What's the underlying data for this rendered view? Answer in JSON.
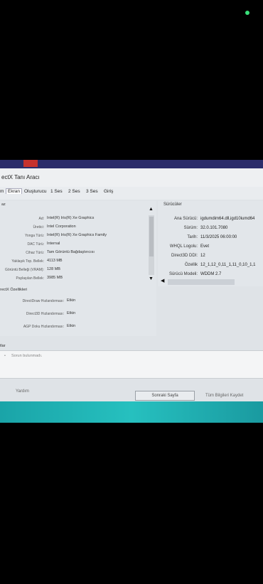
{
  "window": {
    "title": "ectX Tanı Aracı"
  },
  "tabs": [
    {
      "label": "m"
    },
    {
      "label": "Ekran"
    },
    {
      "label": "Oluşturucu"
    },
    {
      "label": "1 Ses"
    },
    {
      "label": "2 Ses"
    },
    {
      "label": "3 Ses"
    },
    {
      "label": "Giriş"
    }
  ],
  "device": {
    "header": "az",
    "rows": [
      {
        "label": "Ad:",
        "value": "Intel(R) Iris(R) Xe Graphics"
      },
      {
        "label": "Üretici:",
        "value": "Intel Corporation"
      },
      {
        "label": "Yonga Türü:",
        "value": "Intel(R) Iris(R) Xe Graphics Family"
      },
      {
        "label": "DAC Türü:",
        "value": "Internal"
      },
      {
        "label": "Cihaz Türü:",
        "value": "Tam Görüntü Bağdaştırıcısı"
      },
      {
        "label": "Yaklaşık Top. Bellek:",
        "value": "4113 MB"
      },
      {
        "label": "Görüntü Belleği (VRAM):",
        "value": "128 MB"
      },
      {
        "label": "Paylaşılan Bellek:",
        "value": "3985 MB"
      }
    ]
  },
  "directx": {
    "header": "rectX Özellikleri",
    "rows": [
      {
        "label": "DirectDraw Hızlandırması:",
        "value": "Etkin"
      },
      {
        "label": "Direct3D Hızlandırması:",
        "value": "Etkin"
      },
      {
        "label": "AGP Doku Hızlandırması:",
        "value": "Etkin"
      }
    ]
  },
  "drivers": {
    "header": "Sürücüler",
    "rows": [
      {
        "label": "Ana Sürücü:",
        "value": "igdumdim64.dll,igd10iumd64"
      },
      {
        "label": "Sürüm:",
        "value": "32.0.101.7080"
      },
      {
        "label": "Tarih:",
        "value": "11/3/2025 06:00:00"
      },
      {
        "label": "WHQL Logolu:",
        "value": "Evet"
      },
      {
        "label": "Direct3D DDI:",
        "value": "12"
      },
      {
        "label": "Özellik",
        "value": "12_1,12_0,11_1,11_0,10_1,1"
      },
      {
        "label": "Sürücü Modeli:",
        "value": "WDDM 2.7"
      }
    ]
  },
  "notes": {
    "header": "tlar",
    "bullet": "•",
    "text": "Sorun bulunmadı."
  },
  "footer": {
    "help": "Yardım",
    "next_page": "Sonraki Sayfa",
    "save_all": "Tüm Bilgileri Kaydet"
  },
  "colors": {
    "screen_bg": "#dfe3e7",
    "taskbar": "#2b2d6a",
    "accent_band": "#1fb3b3",
    "led": "#39e07a"
  }
}
